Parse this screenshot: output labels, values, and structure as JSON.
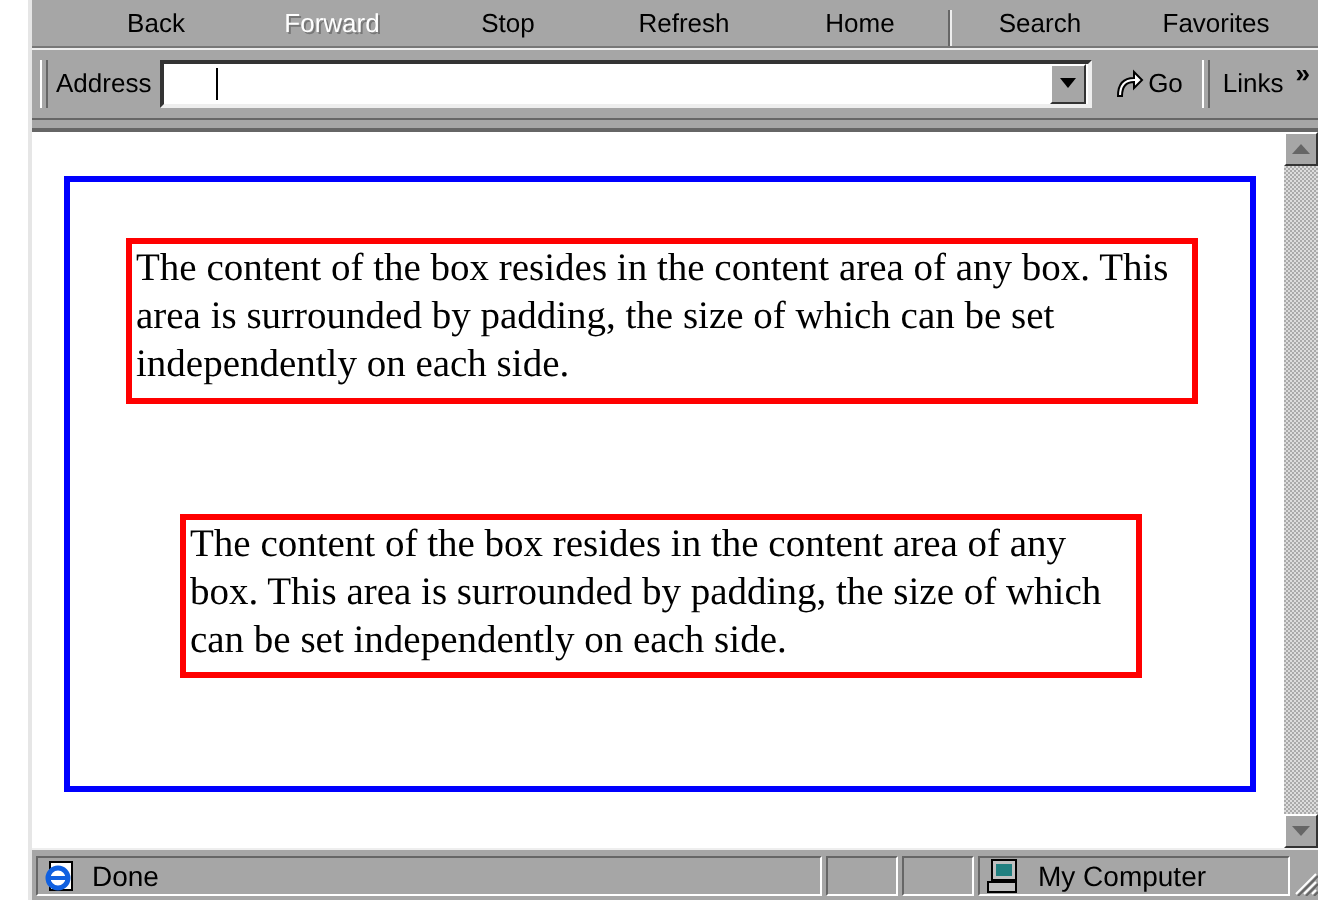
{
  "toolbar": {
    "buttons": [
      {
        "label": "Back",
        "disabled": false
      },
      {
        "label": "Forward",
        "disabled": true
      },
      {
        "label": "Stop",
        "disabled": false
      },
      {
        "label": "Refresh",
        "disabled": false
      },
      {
        "label": "Home",
        "disabled": false
      },
      {
        "label": "Search",
        "disabled": false
      },
      {
        "label": "Favorites",
        "disabled": false
      }
    ]
  },
  "address_bar": {
    "label": "Address",
    "go": "Go",
    "links": "Links",
    "chevron": "»"
  },
  "content": {
    "boxes": [
      {
        "text": "The content of the box resides in the content area of any box. This area is surrounded by padding, the size of which can be set independently on each side."
      },
      {
        "text": "The content of the box resides in the content area of any box. This area is surrounded by padding, the size of which can be set independently on each side."
      }
    ]
  },
  "status_bar": {
    "text": "Done",
    "zone": "My Computer"
  }
}
